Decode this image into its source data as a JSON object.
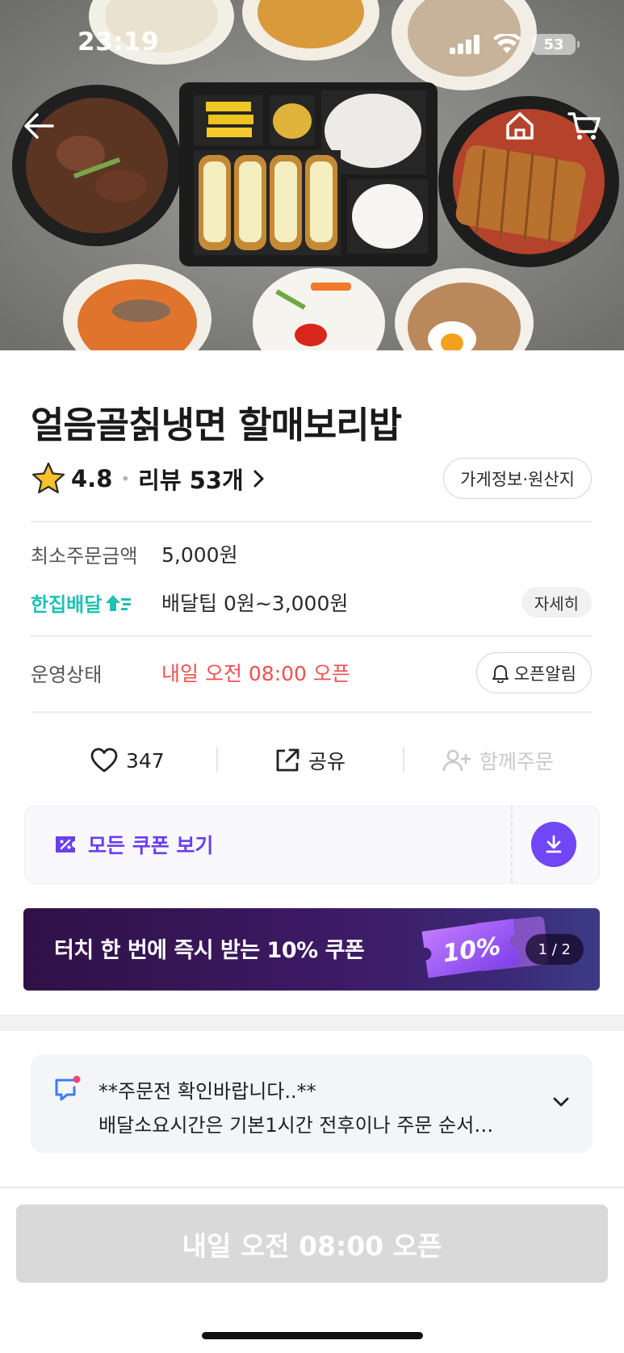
{
  "status_bar": {
    "time": "23:19",
    "battery": "53"
  },
  "store": {
    "name": "얼음골칡냉면 할매보리밥",
    "rating": "4.8",
    "review_label": "리뷰 53개",
    "info_button": "가게정보·원산지"
  },
  "order_info": {
    "min_order_label": "최소주문금액",
    "min_order_value": "5,000원",
    "delivery_brand": "한집배달",
    "delivery_tip": "배달팁 0원~3,000원",
    "detail_button": "자세히",
    "status_label": "운영상태",
    "status_value": "내일 오전 08:00 오픈",
    "alarm_button": "오픈알림"
  },
  "actions": {
    "like_count": "347",
    "share_label": "공유",
    "group_order_label": "함께주문"
  },
  "coupon": {
    "all_coupons_label": "모든 쿠폰 보기",
    "banner_text": "터치 한 번에 즉시 받는 10% 쿠폰",
    "banner_badge": "10%",
    "banner_page": "1 / 2"
  },
  "notice": {
    "line1": "**주문전 확인바랍니다..**",
    "line2": "배달소요시간은 기본1시간 전후이나 주문 순서…"
  },
  "bottom_button": "내일 오전 08:00 오픈",
  "colors": {
    "accent_purple": "#7046F5",
    "delivery_teal": "#1CC2B2",
    "status_red": "#F25050",
    "disabled_gray": "#D9D9D9"
  }
}
